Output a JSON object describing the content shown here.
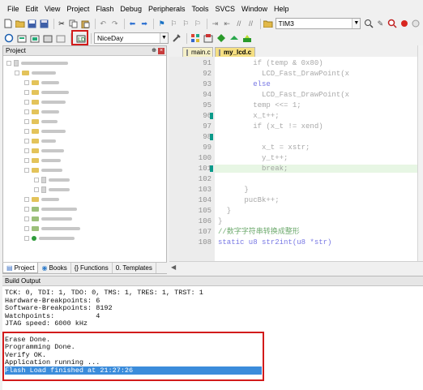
{
  "menu": [
    "File",
    "Edit",
    "View",
    "Project",
    "Flash",
    "Debug",
    "Peripherals",
    "Tools",
    "SVCS",
    "Window",
    "Help"
  ],
  "toolbar1": {
    "target_combo": "TIM3"
  },
  "toolbar2": {
    "target_select": "NiceDay"
  },
  "project_panel": {
    "title": "Project",
    "tabs": [
      "Project",
      "Books",
      "Functions",
      "Templates"
    ]
  },
  "editor": {
    "tabs": [
      "main.c",
      "my_lcd.c"
    ],
    "active_tab": "my_lcd.c",
    "line_numbers": [
      "91",
      "92",
      "93",
      "94",
      "95",
      "96",
      "97",
      "98",
      "99",
      "100",
      "101",
      "102",
      "103",
      "104",
      "105",
      "106",
      "107",
      "108"
    ],
    "lines": [
      "        if (temp & 0x80)",
      "          LCD_Fast_DrawPoint(x",
      "        else",
      "          LCD_Fast_DrawPoint(x",
      "        temp <<= 1;",
      "        x_t++;",
      "        if (x_t != xend)",
      "",
      "          x_t = xstr;",
      "          y_t++;",
      "          break;",
      "",
      "      }",
      "      pucBk++;",
      "  }",
      "}",
      "//数字字符串转换成整形",
      "static u8 str2int(u8 *str)"
    ]
  },
  "build_output": {
    "title": "Build Output",
    "lines": [
      "TCK: 0, TDI: 1, TDO: 0, TMS: 1, TRES: 1, TRST: 1",
      "Hardware-Breakpoints: 6",
      "Software-Breakpoints: 8192",
      "Watchpoints:          4",
      "JTAG speed: 6000 kHz",
      "",
      "Erase Done.",
      "Programming Done.",
      "Verify OK.",
      "Application running ...",
      "Flash Load finished at 21:27:26"
    ]
  },
  "colors": {
    "highlight_box": "#d21b1b",
    "selection": "#3b8cdb",
    "bookmark": "#0b9a8a"
  }
}
